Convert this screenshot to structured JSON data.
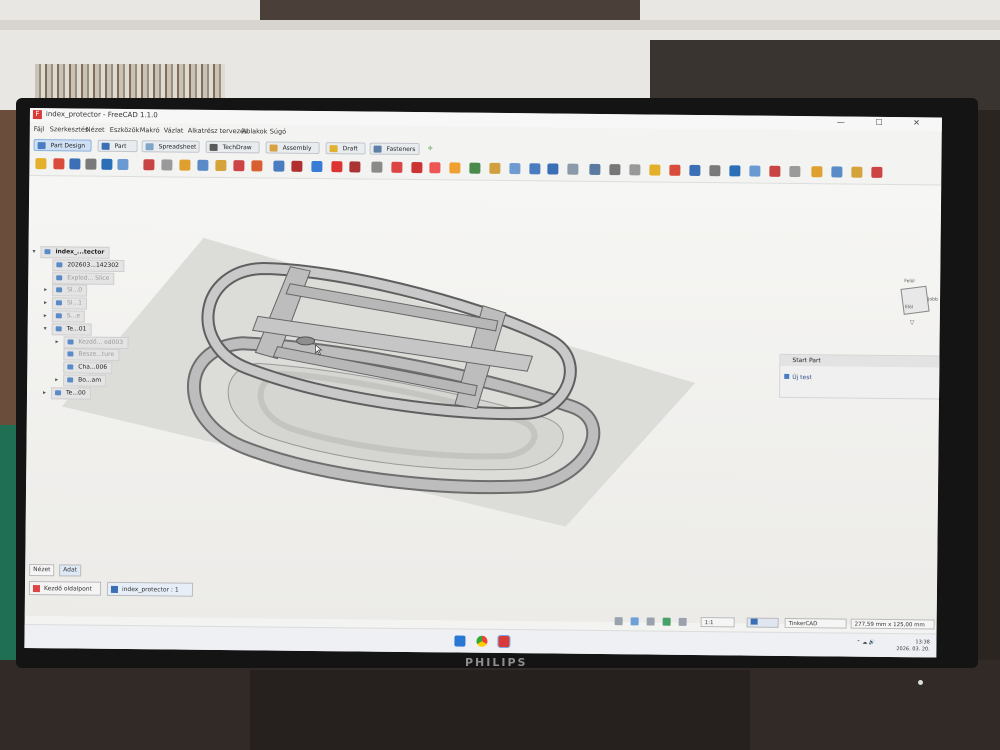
{
  "window": {
    "title": "index_protector - FreeCAD 1.1.0",
    "controls": "— ☐ ✕"
  },
  "menu": [
    "Fájl",
    "Szerkesztés",
    "Nézet",
    "Eszközök",
    "Makró",
    "Vázlat",
    "Alkatrész tervezés",
    "Ablakok",
    "Súgó"
  ],
  "workbenches": [
    {
      "label": "Part Design",
      "active": true,
      "color": "#4a7cc2"
    },
    {
      "label": "Part",
      "active": false,
      "color": "#3d6fb6"
    },
    {
      "label": "Spreadsheet",
      "active": false,
      "color": "#7fa6c9"
    },
    {
      "label": "TechDraw",
      "active": false,
      "color": "#5b5b5b"
    },
    {
      "label": "Assembly",
      "active": false,
      "color": "#d7a043"
    },
    {
      "label": "Draft",
      "active": false,
      "color": "#e0b030"
    },
    {
      "label": "Fasteners",
      "active": false,
      "color": "#5f7fa8"
    }
  ],
  "tree": {
    "root": "index_...tector",
    "items": [
      {
        "label": "202603...142302",
        "indent": 1,
        "dim": false,
        "arrow": ""
      },
      {
        "label": "Explod... Slice",
        "indent": 1,
        "dim": true,
        "arrow": ""
      },
      {
        "label": "Sl...0",
        "indent": 1,
        "dim": true,
        "arrow": "▸"
      },
      {
        "label": "Sl...1",
        "indent": 1,
        "dim": true,
        "arrow": "▸"
      },
      {
        "label": "S...e",
        "indent": 1,
        "dim": true,
        "arrow": "▸"
      },
      {
        "label": "Te...01",
        "indent": 1,
        "dim": false,
        "arrow": "▾"
      },
      {
        "label": "Kezdő... ed003",
        "indent": 2,
        "dim": true,
        "arrow": "▸"
      },
      {
        "label": "Besze...ture",
        "indent": 2,
        "dim": true,
        "arrow": ""
      },
      {
        "label": "Cha...006",
        "indent": 2,
        "dim": false,
        "arrow": ""
      },
      {
        "label": "Bo...am",
        "indent": 2,
        "dim": false,
        "arrow": "▸"
      },
      {
        "label": "Te...00",
        "indent": 1,
        "dim": false,
        "arrow": "▸"
      }
    ]
  },
  "navcube": {
    "top": "Felül",
    "front": "Elöl",
    "side": "Jobb"
  },
  "tasks": {
    "header": "Start Part",
    "item": "Új test"
  },
  "panel_tabs": [
    "Nézet",
    "Adat"
  ],
  "document_tabs": [
    {
      "label": "Kezdő oldalpont",
      "active": false
    },
    {
      "label": "index_protector : 1",
      "active": true
    }
  ],
  "status": {
    "zoom": "1:1",
    "nav_style": "TinkerCAD",
    "dimensions": "277,59 mm x 125,00 mm"
  },
  "taskbar": {
    "time": "13:38",
    "date": "2026. 03. 20."
  },
  "monitor_brand": "PHILIPS"
}
